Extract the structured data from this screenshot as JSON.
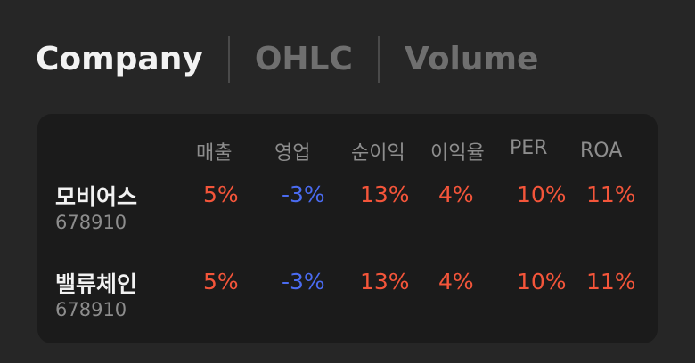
{
  "tabs": [
    {
      "label": "Company",
      "active": true
    },
    {
      "label": "OHLC",
      "active": false
    },
    {
      "label": "Volume",
      "active": false
    }
  ],
  "table": {
    "columns": [
      "매출",
      "영업",
      "순이익",
      "이익율",
      "PER",
      "ROA"
    ],
    "rows": [
      {
        "name": "모비어스",
        "code": "678910",
        "values": [
          "5%",
          "-3%",
          "13%",
          "4%",
          "10%",
          "11%"
        ]
      },
      {
        "name": "밸류체인",
        "code": "678910",
        "values": [
          "5%",
          "-3%",
          "13%",
          "4%",
          "10%",
          "11%"
        ]
      }
    ]
  },
  "colors": {
    "positive": "#f4553a",
    "negative": "#4a6bf0",
    "background": "#262626",
    "card": "#1b1b1b",
    "text_primary": "#f2f2f2",
    "text_muted": "#8d8d8d"
  }
}
